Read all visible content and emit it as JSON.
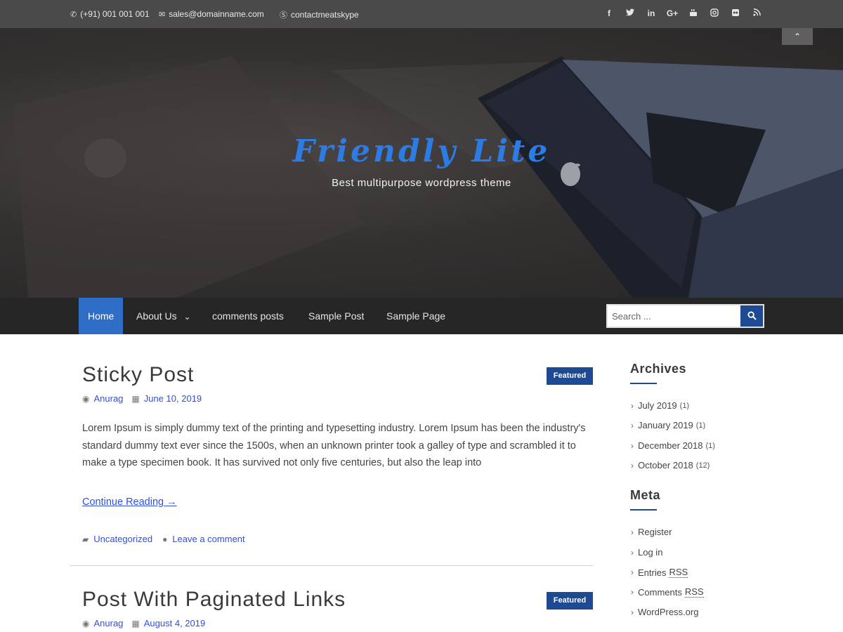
{
  "topbar": {
    "phone": "(+91) 001 001 001",
    "email": "sales@domainname.com",
    "skype": "contactmeatskype",
    "social": [
      "f",
      "t",
      "in",
      "G+",
      "yt",
      "ig",
      "fl",
      "rss"
    ]
  },
  "hero": {
    "title": "Friendly Lite",
    "tagline": "Best multipurpose wordpress theme",
    "scroll_icon": "⌃"
  },
  "nav": {
    "items": [
      "Home",
      "About Us",
      "comments posts",
      "Sample Post",
      "Sample Page"
    ],
    "about_caret": "⌄",
    "search_placeholder": "Search ..."
  },
  "posts": [
    {
      "title": "Sticky Post",
      "badge": "Featured",
      "author": "Anurag",
      "date": "June 10, 2019",
      "excerpt": "Lorem Ipsum is simply dummy text of the printing and typesetting industry. Lorem Ipsum has been the industry's standard dummy text ever since the 1500s, when an unknown printer took a galley of type and scrambled it to make a type specimen book. It has survived not only five centuries, but also the leap into",
      "read_more": "Continue Reading →",
      "category": "Uncategorized",
      "comment": "Leave a comment"
    },
    {
      "title": "Post With Paginated Links",
      "badge": "Featured",
      "author": "Anurag",
      "date": "August 4, 2019"
    }
  ],
  "sidebar": {
    "archives_title": "Archives",
    "archives": [
      {
        "label": "July 2019",
        "count": "(1)"
      },
      {
        "label": "January 2019",
        "count": "(1)"
      },
      {
        "label": "December 2018",
        "count": "(1)"
      },
      {
        "label": "October 2018",
        "count": "(12)"
      }
    ],
    "meta_title": "Meta",
    "meta": {
      "register": "Register",
      "login": "Log in",
      "entries_prefix": "Entries",
      "entries_abbr": "RSS",
      "comments_prefix": "Comments",
      "comments_abbr": "RSS",
      "wordpress": "WordPress.org"
    }
  },
  "colors": {
    "accent": "#2f6ec7",
    "badge": "#1d4a93",
    "title_blue": "#2d7be5",
    "link": "#2d4fe8"
  }
}
